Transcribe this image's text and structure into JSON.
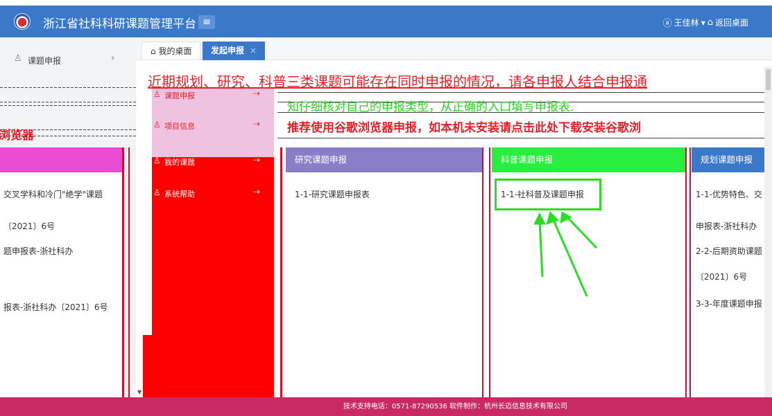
{
  "header": {
    "title": "浙江省社科科研课题管理平台",
    "user": "王佳林",
    "back_label": "返回桌面"
  },
  "sidebar": {
    "item": {
      "label": "课题申报"
    },
    "red_text": "浏览器"
  },
  "tabs": {
    "home": "我的桌面",
    "active": "发起申报",
    "close_glyph": "×"
  },
  "notices": {
    "line1": "近期规划、研究、科普三类课题可能存在同时申报的情况，请各申报人结合申报通",
    "line2": "知仔细核对自己的申报类型，从正确的入口填写申报表.",
    "line3": "推荐使用谷歌浏览器申报，如本机未安装请点击此处下载安装谷歌浏"
  },
  "dropdown": {
    "items": [
      {
        "label": "课题申报"
      },
      {
        "label": "项目信息"
      },
      {
        "label": "我的课题"
      },
      {
        "label": "系统帮助"
      }
    ]
  },
  "columns": {
    "left": {
      "items": [
        "交叉学科和冷门\"绝学\"课题",
        "〔2021〕6号",
        "题申报表-浙社科办",
        "报表-浙社科办〔2021〕6号"
      ]
    },
    "research": {
      "title": "研究课题申报",
      "items": [
        "1-1-研究课题申报表"
      ]
    },
    "science": {
      "title": "科普课题申报",
      "items": [
        "1-1-社科普及课题申报"
      ]
    },
    "plan": {
      "title": "规划课题申报",
      "items": [
        "1-1-优势特色、交",
        "申报表-浙社科办",
        "2-2-后期资助课题",
        "〔2021〕6号",
        "3-3-年度课题申报"
      ]
    }
  },
  "footer": {
    "text": "技术支持电话：0571-87290536 软件制作：杭州长迈信息技术有限公司"
  },
  "colors": {
    "header_bg": "#3a79c9",
    "footer_bg": "#c92a63",
    "research_head": "#8a7ec9",
    "science_head": "#28ef3f",
    "plan_head": "#3a79c9",
    "alert_red": "#e52128",
    "alert_green": "#24d61e"
  }
}
